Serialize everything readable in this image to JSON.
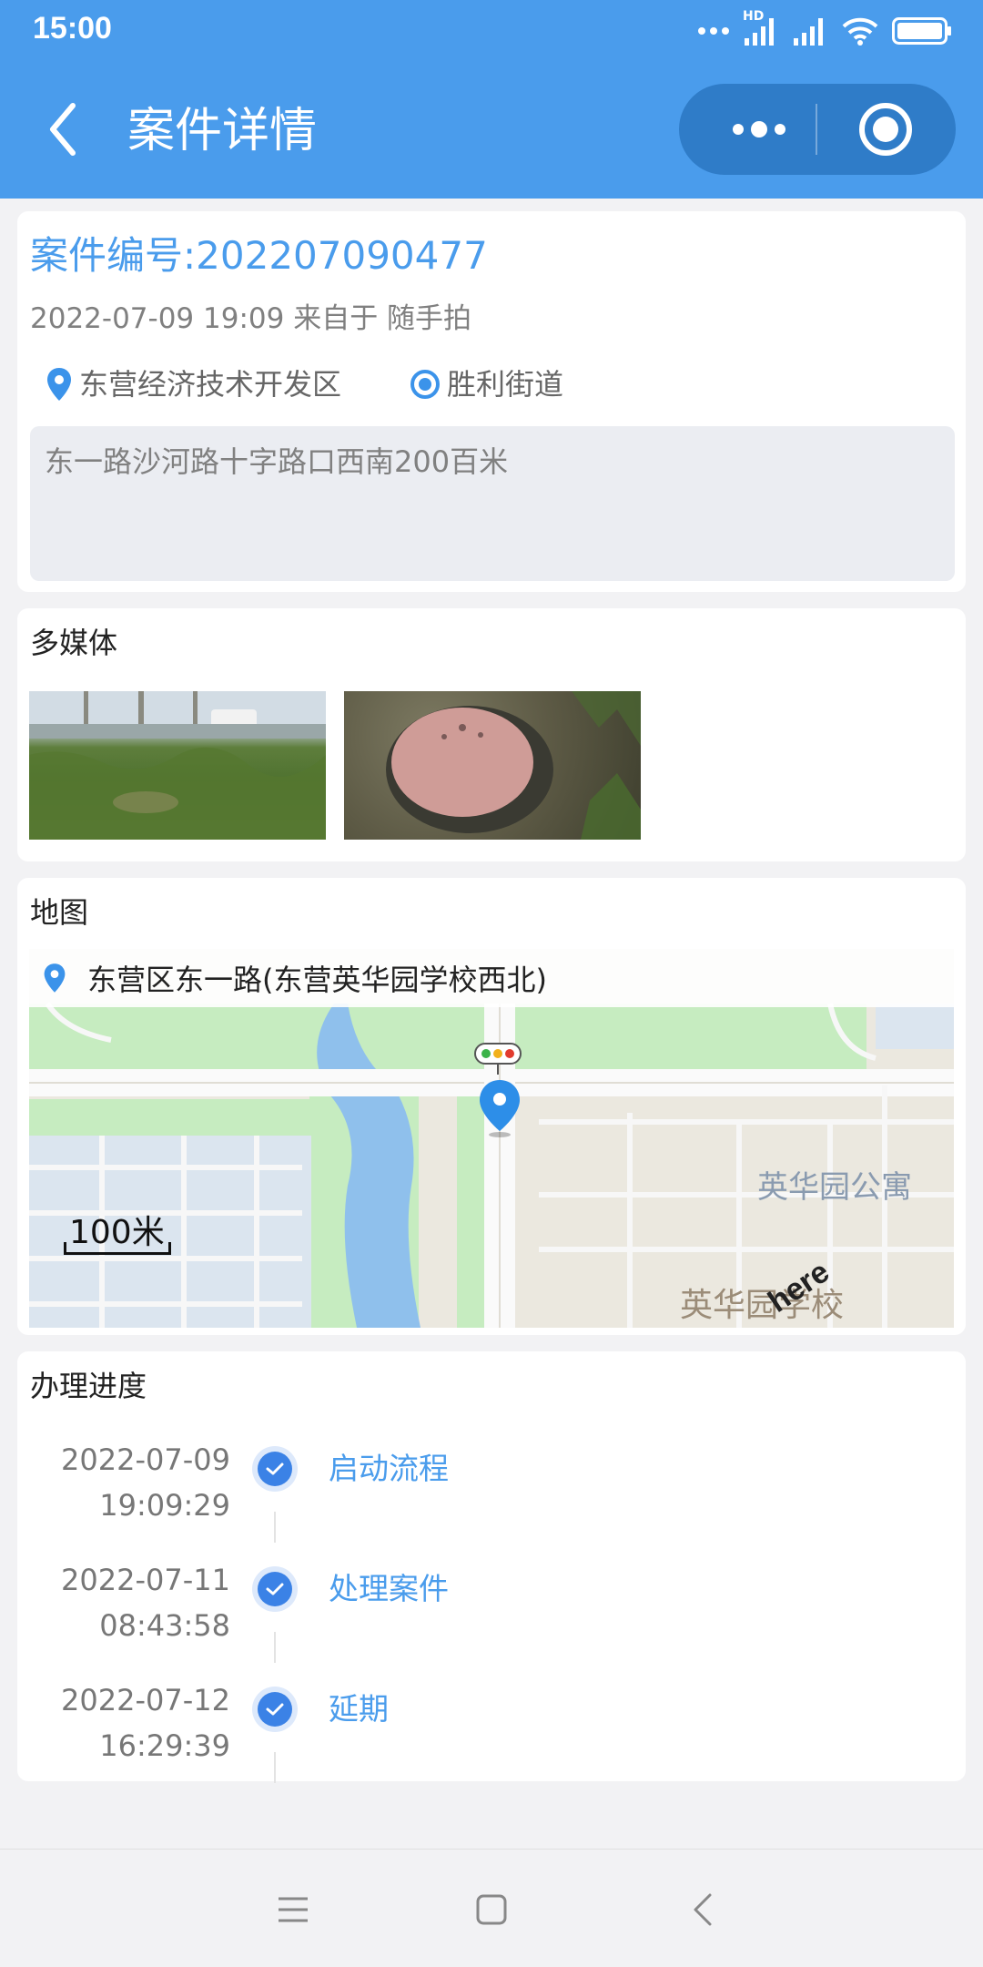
{
  "status_bar": {
    "time": "15:00",
    "network_label": "HD"
  },
  "header": {
    "title": "案件详情"
  },
  "case": {
    "number": "案件编号:202207090477",
    "meta": "2022-07-09 19:09 来自于 随手拍",
    "district": "东营经济技术开发区",
    "street": "胜利街道",
    "address": "东一路沙河路十字路口西南200百米"
  },
  "media": {
    "title": "多媒体"
  },
  "map": {
    "title": "地图",
    "location": "东营区东一路(东营英华园学校西北)",
    "scale": "100米",
    "labels": [
      "英华园公寓",
      "英华园学校"
    ],
    "provider": "here"
  },
  "progress": {
    "title": "办理进度",
    "steps": [
      {
        "date": "2022-07-09",
        "time": "19:09:29",
        "label": "启动流程"
      },
      {
        "date": "2022-07-11",
        "time": "08:43:58",
        "label": "处理案件"
      },
      {
        "date": "2022-07-12",
        "time": "16:29:39",
        "label": "延期"
      }
    ]
  },
  "colors": {
    "accent": "#4a9cec",
    "header_bg": "#4a9cec",
    "check": "#3b82e6"
  }
}
